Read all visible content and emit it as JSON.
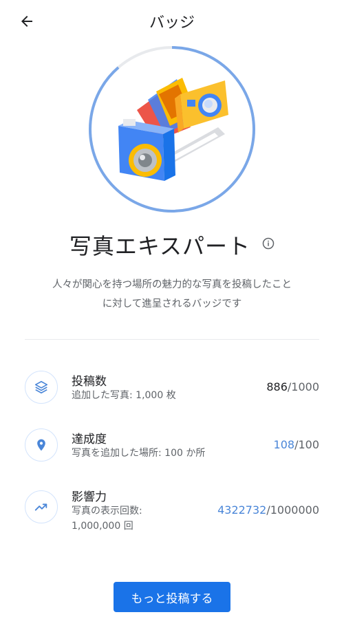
{
  "header": {
    "title": "バッジ"
  },
  "badge": {
    "name": "写真エキスパート",
    "description_line1": "人々が関心を持つ場所の魅力的な写真を投稿したこと",
    "description_line2": "に対して進呈されるバッジです",
    "progress_fraction": 0.886
  },
  "stats": [
    {
      "title": "投稿数",
      "subtitle": "追加した写真: 1,000 枚",
      "value": "886",
      "total": "/1000",
      "icon": "layers-icon"
    },
    {
      "title": "達成度",
      "subtitle": "写真を追加した場所: 100 か所",
      "value": "108",
      "total": "/100",
      "icon": "location-pin-icon"
    },
    {
      "title": "影響力",
      "subtitle_line1": "写真の表示回数:",
      "subtitle_line2": "1,000,000 回",
      "value": "4322732",
      "total": "/1000000",
      "icon": "trending-up-icon"
    }
  ],
  "cta": {
    "label": "もっと投稿する"
  },
  "colors": {
    "accent": "#1a73e8",
    "ring": "#7aa7e8",
    "ring_track": "#e8eaed"
  }
}
